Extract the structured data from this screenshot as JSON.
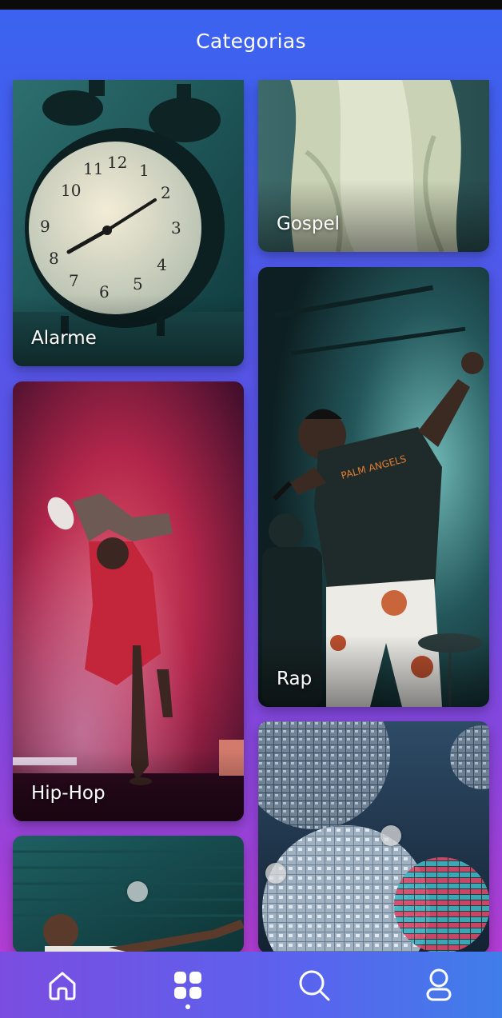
{
  "header": {
    "title": "Categorias"
  },
  "categories": [
    {
      "label": "Alarme"
    },
    {
      "label": "Gospel"
    },
    {
      "label": "Rap"
    },
    {
      "label": "Hip-Hop"
    },
    {
      "label": ""
    },
    {
      "label": ""
    }
  ],
  "bottom_nav": {
    "items": [
      {
        "icon": "home-icon",
        "active": false
      },
      {
        "icon": "grid-icon",
        "active": true
      },
      {
        "icon": "search-icon",
        "active": false
      },
      {
        "icon": "profile-icon",
        "active": false
      }
    ]
  },
  "colors": {
    "gradient_top": "#3a63f1",
    "gradient_bottom": "#c03ad0",
    "nav_left": "#7a4de0",
    "nav_right": "#3f7ee9"
  }
}
